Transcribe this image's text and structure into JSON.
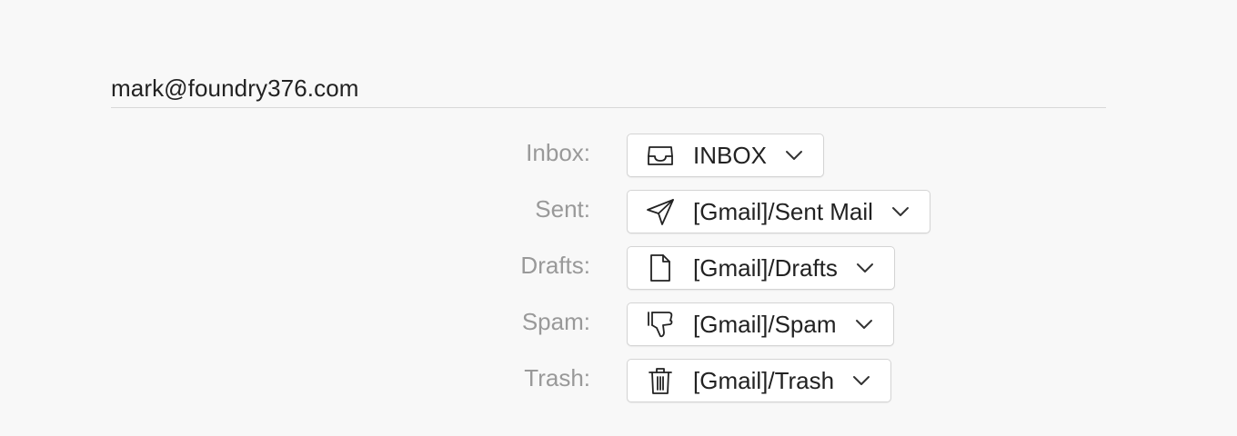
{
  "account": {
    "email": "mark@foundry376.com"
  },
  "folders": [
    {
      "label": "Inbox:",
      "value": "INBOX",
      "icon": "inbox-icon"
    },
    {
      "label": "Sent:",
      "value": "[Gmail]/Sent Mail",
      "icon": "send-icon"
    },
    {
      "label": "Drafts:",
      "value": "[Gmail]/Drafts",
      "icon": "document-icon"
    },
    {
      "label": "Spam:",
      "value": "[Gmail]/Spam",
      "icon": "thumbs-down-icon"
    },
    {
      "label": "Trash:",
      "value": "[Gmail]/Trash",
      "icon": "trash-icon"
    }
  ],
  "colors": {
    "background": "#f8f8f8",
    "label": "#999999",
    "text": "#222222",
    "border": "#d4d4d4"
  }
}
